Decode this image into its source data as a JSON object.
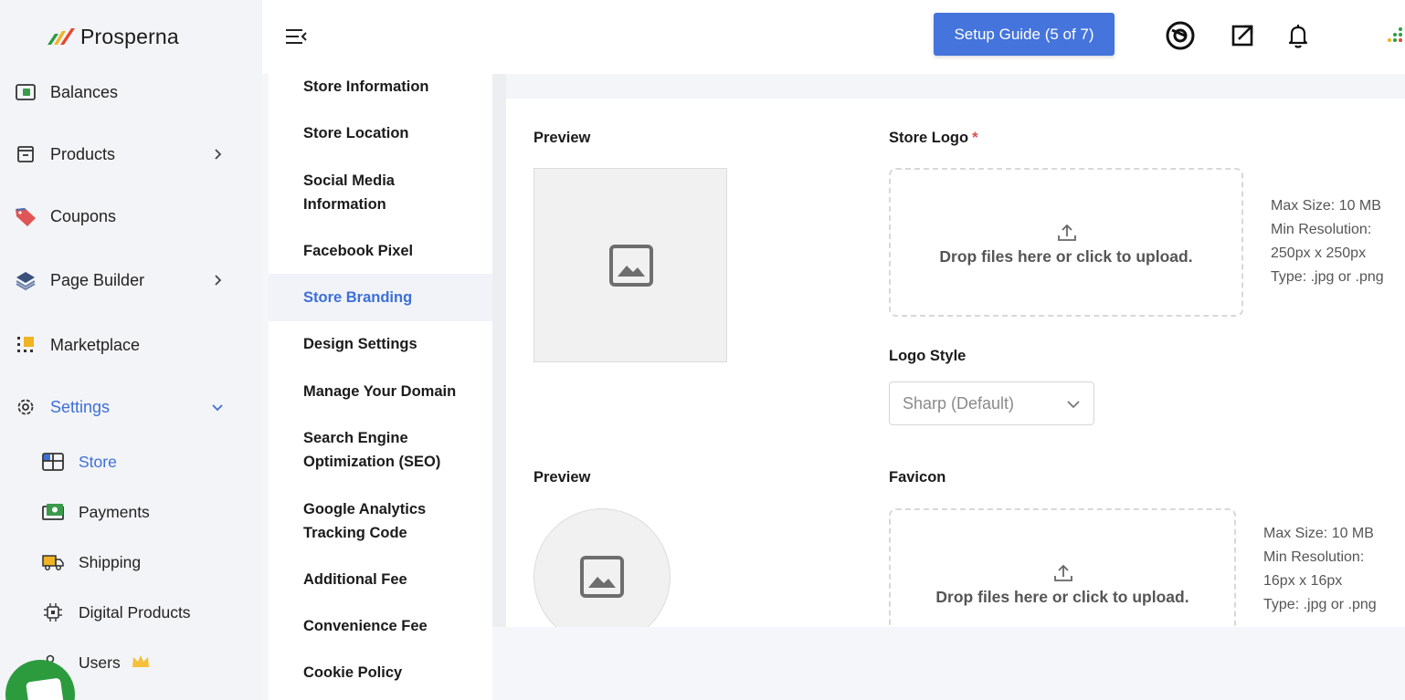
{
  "brand": {
    "name": "Prosperna"
  },
  "sidebar": {
    "items": [
      {
        "label": "Balances",
        "icon": "wallet-icon"
      },
      {
        "label": "Products",
        "icon": "box-icon",
        "chevron": ">"
      },
      {
        "label": "Coupons",
        "icon": "tag-icon"
      },
      {
        "label": "Page Builder",
        "icon": "layers-icon",
        "chevron": ">"
      },
      {
        "label": "Marketplace",
        "icon": "marketplace-icon"
      },
      {
        "label": "Settings",
        "icon": "gear-icon",
        "chevron": "v",
        "active": true
      }
    ],
    "subitems": [
      {
        "label": "Store",
        "icon": "store-icon",
        "active": true
      },
      {
        "label": "Payments",
        "icon": "payments-icon"
      },
      {
        "label": "Shipping",
        "icon": "truck-icon"
      },
      {
        "label": "Digital Products",
        "icon": "chip-icon"
      },
      {
        "label": "Users",
        "icon": "users-icon",
        "badge": "crown-icon"
      }
    ]
  },
  "header": {
    "setup_guide": "Setup Guide (5 of 7)"
  },
  "submenu": {
    "items": [
      {
        "label": "Store Information"
      },
      {
        "label": "Store Location"
      },
      {
        "label": "Social Media Information"
      },
      {
        "label": "Facebook Pixel"
      },
      {
        "label": "Store Branding",
        "active": true
      },
      {
        "label": "Design Settings"
      },
      {
        "label": "Manage Your Domain"
      },
      {
        "label": "Search Engine Optimization (SEO)"
      },
      {
        "label": "Google Analytics Tracking Code"
      },
      {
        "label": "Additional Fee"
      },
      {
        "label": "Convenience Fee"
      },
      {
        "label": "Cookie Policy"
      }
    ]
  },
  "branding": {
    "logo_section": {
      "preview_label": "Preview",
      "field_label": "Store Logo",
      "required_mark": "*",
      "upload_text": "Drop files here or click to upload.",
      "specs": [
        "Max Size: 10 MB",
        "Min Resolution:",
        "250px x 250px",
        "Type: .jpg or .png"
      ]
    },
    "logo_style": {
      "label": "Logo Style",
      "selected": "Sharp (Default)"
    },
    "favicon_section": {
      "preview_label": "Preview",
      "field_label": "Favicon",
      "upload_text": "Drop files here or click to upload.",
      "specs": [
        "Max Size: 10 MB",
        "Min Resolution:",
        "16px x 16px",
        "Type: .jpg or .png"
      ]
    }
  },
  "colors": {
    "accent": "#3c6fd8",
    "button": "#4474dc",
    "chat": "#2c9b3e",
    "required": "#e24a4a"
  }
}
